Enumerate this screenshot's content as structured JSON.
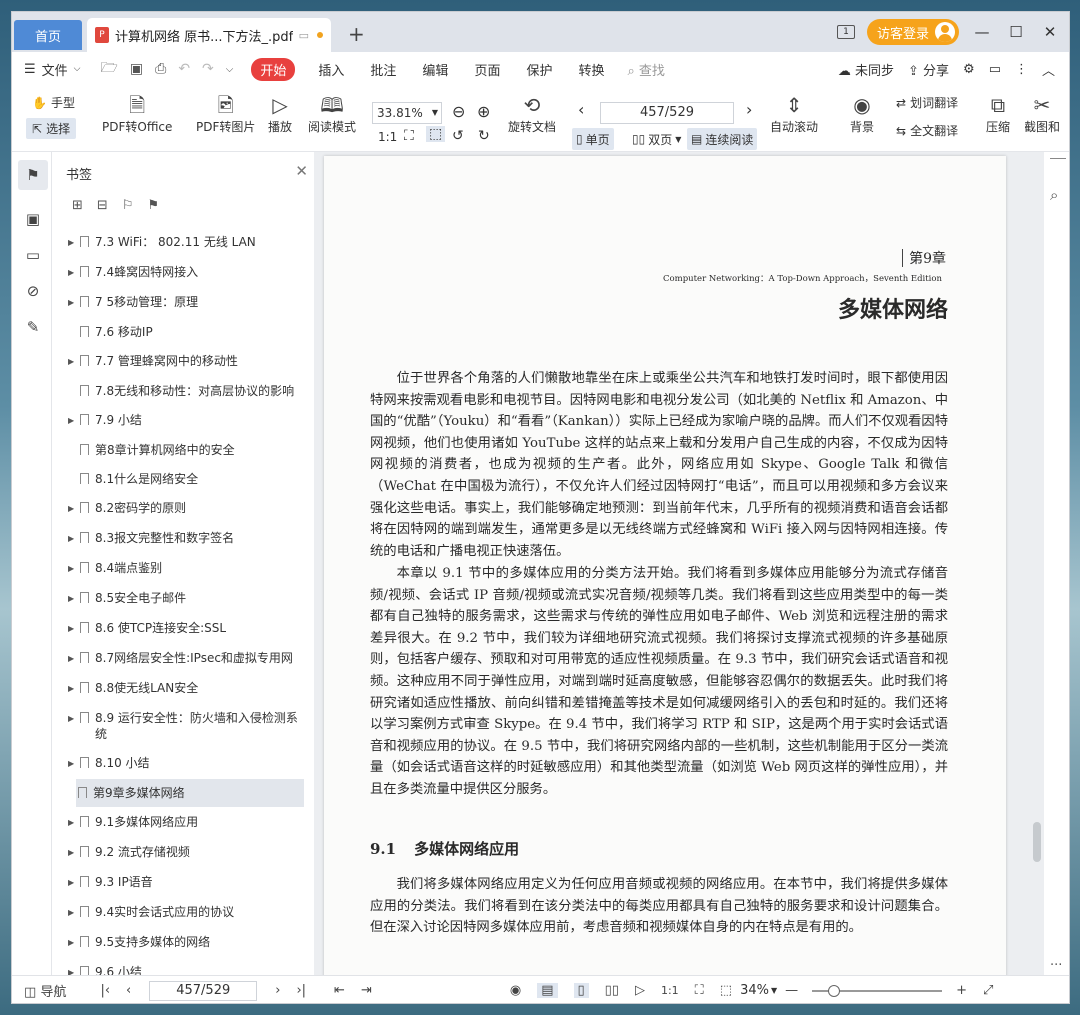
{
  "tabs": {
    "home": "首页",
    "doc_title": "计算机网络 原书...下方法_.pdf"
  },
  "header": {
    "login": "访客登录"
  },
  "menu": {
    "file": "文件",
    "start": "开始",
    "items": [
      "插入",
      "批注",
      "编辑",
      "页面",
      "保护",
      "转换"
    ],
    "search_placeholder": "查找",
    "sync": "未同步",
    "share": "分享"
  },
  "toolbar": {
    "hand": "手型",
    "select": "选择",
    "pdf_to_office": "PDF转Office",
    "pdf_to_image": "PDF转图片",
    "play": "播放",
    "read_mode": "阅读模式",
    "zoom": "33.81%",
    "rotate_doc": "旋转文档",
    "page": "457/529",
    "single_page": "单页",
    "double_page": "双页",
    "continuous": "连续阅读",
    "auto_scroll": "自动滚动",
    "background": "背景",
    "word_translate": "划词翻译",
    "full_translate": "全文翻译",
    "compress": "压缩",
    "screenshot": "截图和"
  },
  "bookmarks": {
    "title": "书签",
    "items": [
      {
        "label": "7.3 WiFi： 802.11 无线 LAN",
        "arrow": true
      },
      {
        "label": "7.4蜂窝因特网接入",
        "arrow": true
      },
      {
        "label": "7 5移动管理：原理",
        "arrow": true
      },
      {
        "label": "7.6 移动IP",
        "arrow": false
      },
      {
        "label": "7.7 管理蜂窝网中的移动性",
        "arrow": true
      },
      {
        "label": "7.8无线和移动性：对高层协议的影响",
        "arrow": false
      },
      {
        "label": "7.9 小结",
        "arrow": true
      },
      {
        "label": "第8章计算机网络中的安全",
        "arrow": false
      },
      {
        "label": "8.1什么是网络安全",
        "arrow": false
      },
      {
        "label": "8.2密码学的原则",
        "arrow": true
      },
      {
        "label": "8.3报文完整性和数字签名",
        "arrow": true
      },
      {
        "label": "8.4端点鉴别",
        "arrow": true
      },
      {
        "label": "8.5安全电子邮件",
        "arrow": true
      },
      {
        "label": "8.6 使TCP连接安全:SSL",
        "arrow": true
      },
      {
        "label": "8.7网络层安全性:IPsec和虚拟专用网",
        "arrow": true
      },
      {
        "label": "8.8使无线LAN安全",
        "arrow": true
      },
      {
        "label": "8.9 运行安全性：防火墙和入侵检测系统",
        "arrow": true
      },
      {
        "label": "8.10 小结",
        "arrow": true
      },
      {
        "label": "第9章多媒体网络",
        "arrow": false,
        "selected": true
      },
      {
        "label": "9.1多媒体网络应用",
        "arrow": true
      },
      {
        "label": "9.2 流式存储视频",
        "arrow": true
      },
      {
        "label": "9.3 IP语音",
        "arrow": true
      },
      {
        "label": "9.4实时会话式应用的协议",
        "arrow": true
      },
      {
        "label": "9.5支持多媒体的网络",
        "arrow": true
      },
      {
        "label": "9.6 小结",
        "arrow": true
      }
    ]
  },
  "page_content": {
    "chapter": "第9章",
    "chapter_sub": "Computer Networking：A Top-Down Approach，Seventh Edition",
    "chapter_title": "多媒体网络",
    "para1": "位于世界各个角落的人们懒散地靠坐在床上或乘坐公共汽车和地铁打发时间时，眼下都使用因特网来按需观看电影和电视节目。因特网电影和电视分发公司（如北美的 Netflix 和 Amazon、中国的“优酷”（Youku）和“看看”（Kankan））实际上已经成为家喻户晓的品牌。而人们不仅观看因特网视频，他们也使用诸如 YouTube 这样的站点来上载和分发用户自己生成的内容，不仅成为因特网视频的消费者，也成为视频的生产者。此外，网络应用如 Skype、Google Talk 和微信（WeChat 在中国极为流行），不仅允许人们经过因特网打“电话”，而且可以用视频和多方会议来强化这些电话。事实上，我们能够确定地预测：到当前年代末，几乎所有的视频消费和语音会话都将在因特网的端到端发生，通常更多是以无线终端方式经蜂窝和 WiFi 接入网与因特网相连接。传统的电话和广播电视正快速落伍。",
    "para2": "本章以 9.1 节中的多媒体应用的分类方法开始。我们将看到多媒体应用能够分为流式存储音频/视频、会话式 IP 音频/视频或流式实况音频/视频等几类。我们将看到这些应用类型中的每一类都有自己独特的服务需求，这些需求与传统的弹性应用如电子邮件、Web 浏览和远程注册的需求差异很大。在 9.2 节中，我们较为详细地研究流式视频。我们将探讨支撑流式视频的许多基础原则，包括客户缓存、预取和对可用带宽的适应性视频质量。在 9.3 节中，我们研究会话式语音和视频。这种应用不同于弹性应用，对端到端时延高度敏感，但能够容忍偶尔的数据丢失。此时我们将研究诸如适应性播放、前向纠错和差错掩盖等技术是如何减缓网络引入的丢包和时延的。我们还将以学习案例方式审查 Skype。在 9.4 节中，我们将学习 RTP 和 SIP，这是两个用于实时会话式语音和视频应用的协议。在 9.5 节中，我们将研究网络内部的一些机制，这些机制能用于区分一类流量（如会话式语音这样的时延敏感应用）和其他类型流量（如浏览 Web 网页这样的弹性应用），并且在多类流量中提供区分服务。",
    "section_num": "9.1",
    "section_title": "多媒体网络应用",
    "para3": "我们将多媒体网络应用定义为任何应用音频或视频的网络应用。在本节中，我们将提供多媒体应用的分类法。我们将看到在该分类法中的每类应用都具有自己独特的服务要求和设计问题集合。但在深入讨论因特网多媒体应用前，考虑音频和视频媒体自身的内在特点是有用的。"
  },
  "status": {
    "nav": "导航",
    "page": "457/529",
    "zoom": "34%"
  }
}
